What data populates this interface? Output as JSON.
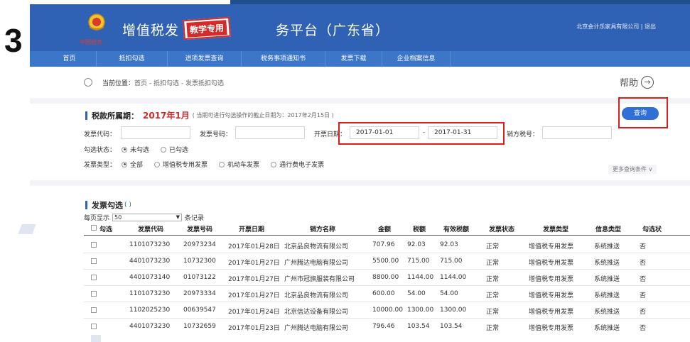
{
  "step_number": "3",
  "header": {
    "emblem_text": "中国税务",
    "brand_left": "增值税发",
    "brand_right": "务平台（广东省）",
    "stamp": "教学专用",
    "account": "北京会计乐家具有限公司 | 退出"
  },
  "nav": {
    "items": [
      {
        "label": "首页"
      },
      {
        "label": "抵扣勾选"
      },
      {
        "label": "进项发票查询"
      },
      {
        "label": "税务事项通知书"
      },
      {
        "label": "发票下载"
      },
      {
        "label": "企业档案信息"
      }
    ]
  },
  "breadcrumb": {
    "label": "当前位置：",
    "path": "首页 - 抵扣勾选 - 发票抵扣勾选"
  },
  "help": {
    "label": "帮助",
    "arrow": "→"
  },
  "filter": {
    "title": "税款所属期：",
    "period": "2017年1月",
    "note": "( 当期可进行勾选操作的截止日期为：2017年2月15日 )",
    "query_button": "查询",
    "invoice_code_label": "发票代码：",
    "invoice_code_value": "",
    "invoice_no_label": "发票号码：",
    "invoice_no_value": "",
    "date_label": "开票日期：",
    "date_from": "2017-01-01",
    "date_sep": "-",
    "date_to": "2017-01-31",
    "seller_tax_label": "销方税号：",
    "seller_tax_value": "",
    "check_status_label": "勾选状态：",
    "check_status_options": [
      "未勾选",
      "已勾选"
    ],
    "invoice_type_label": "发票类型：",
    "invoice_type_options": [
      "全部",
      "增值税专用发票",
      "机动车发票",
      "通行费电子发票"
    ],
    "more_conditions": "更多查询条件 ∨"
  },
  "table": {
    "title": "发票勾选",
    "title_paren": "( )",
    "page_size_prefix": "每页显示",
    "page_size": "50",
    "page_size_arrow": "▼",
    "page_size_suffix": "条记录",
    "headers": [
      "勾选",
      "发票代码",
      "发票号码",
      "开票日期",
      "销方名称",
      "金额",
      "税额",
      "有效税额",
      "发票状态",
      "发票类型",
      "信息类型",
      "勾选状"
    ],
    "rows": [
      {
        "code": "1101073230",
        "number": "20973234",
        "date": "2017年01月28日",
        "seller": "北京品良物流有限公司",
        "amount": "707.96",
        "tax": "92.03",
        "valid_tax": "92.03",
        "status": "正常",
        "type": "增值税专用发票",
        "info": "系统推送",
        "checked": "否"
      },
      {
        "code": "4401073230",
        "number": "10732300",
        "date": "2017年01月27日",
        "seller": "广州腾达电脑有限公司",
        "amount": "5500.00",
        "tax": "715.00",
        "valid_tax": "715.00",
        "status": "正常",
        "type": "增值税专用发票",
        "info": "系统推送",
        "checked": "否"
      },
      {
        "code": "4401073140",
        "number": "01073122",
        "date": "2017年01月27日",
        "seller": "广州市冠旗服装有限公司",
        "amount": "8800.00",
        "tax": "1144.00",
        "valid_tax": "1144.00",
        "status": "正常",
        "type": "增值税专用发票",
        "info": "系统推送",
        "checked": "否"
      },
      {
        "code": "1101073230",
        "number": "20973334",
        "date": "2017年01月27日",
        "seller": "北京品良物流有限公司",
        "amount": "600.00",
        "tax": "54.00",
        "valid_tax": "54.00",
        "status": "正常",
        "type": "增值税专用发票",
        "info": "系统推送",
        "checked": "否"
      },
      {
        "code": "1102025230",
        "number": "00639547",
        "date": "2017年01月24日",
        "seller": "北京信达设备有限公司",
        "amount": "10000.00",
        "tax": "1300.00",
        "valid_tax": "1300.00",
        "status": "正常",
        "type": "增值税专用发票",
        "info": "系统推送",
        "checked": "否"
      },
      {
        "code": "4401073230",
        "number": "10732659",
        "date": "2017年01月23日",
        "seller": "广州腾达电脑有限公司",
        "amount": "796.46",
        "tax": "103.54",
        "valid_tax": "103.54",
        "status": "正常",
        "type": "增值税专用发票",
        "info": "系统推送",
        "checked": "否"
      }
    ]
  },
  "colors": {
    "header": "#2f62b4",
    "nav": "#3b76c8",
    "accent_red": "#d42a2a",
    "highlight": "#e01b1b",
    "button": "#2f6fd6"
  }
}
